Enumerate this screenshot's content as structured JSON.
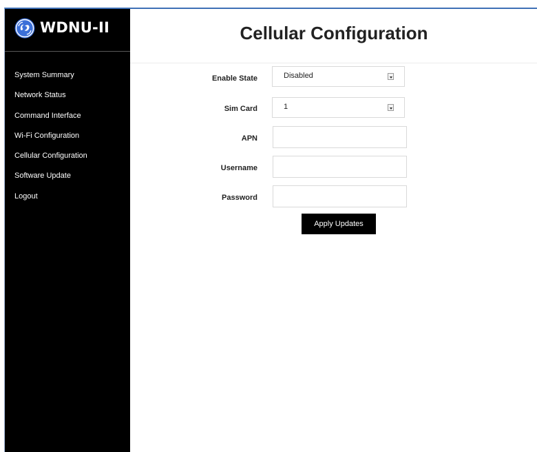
{
  "brand": {
    "name": "WDNU-II",
    "logo": "ge-logo"
  },
  "sidebar": {
    "items": [
      {
        "label": "System Summary"
      },
      {
        "label": "Network Status"
      },
      {
        "label": "Command Interface"
      },
      {
        "label": "Wi-Fi Configuration"
      },
      {
        "label": "Cellular Configuration"
      },
      {
        "label": "Software Update"
      },
      {
        "label": "Logout"
      }
    ]
  },
  "page": {
    "title": "Cellular Configuration"
  },
  "form": {
    "enable_state": {
      "label": "Enable State",
      "value": "Disabled"
    },
    "sim_card": {
      "label": "Sim Card",
      "value": "1"
    },
    "apn": {
      "label": "APN",
      "value": ""
    },
    "username": {
      "label": "Username",
      "value": ""
    },
    "password": {
      "label": "Password",
      "value": ""
    },
    "apply_label": "Apply Updates"
  },
  "colors": {
    "sidebar_bg": "#000000",
    "frame_accent": "#3d6fb5",
    "logo_blue": "#3b6fd8"
  }
}
